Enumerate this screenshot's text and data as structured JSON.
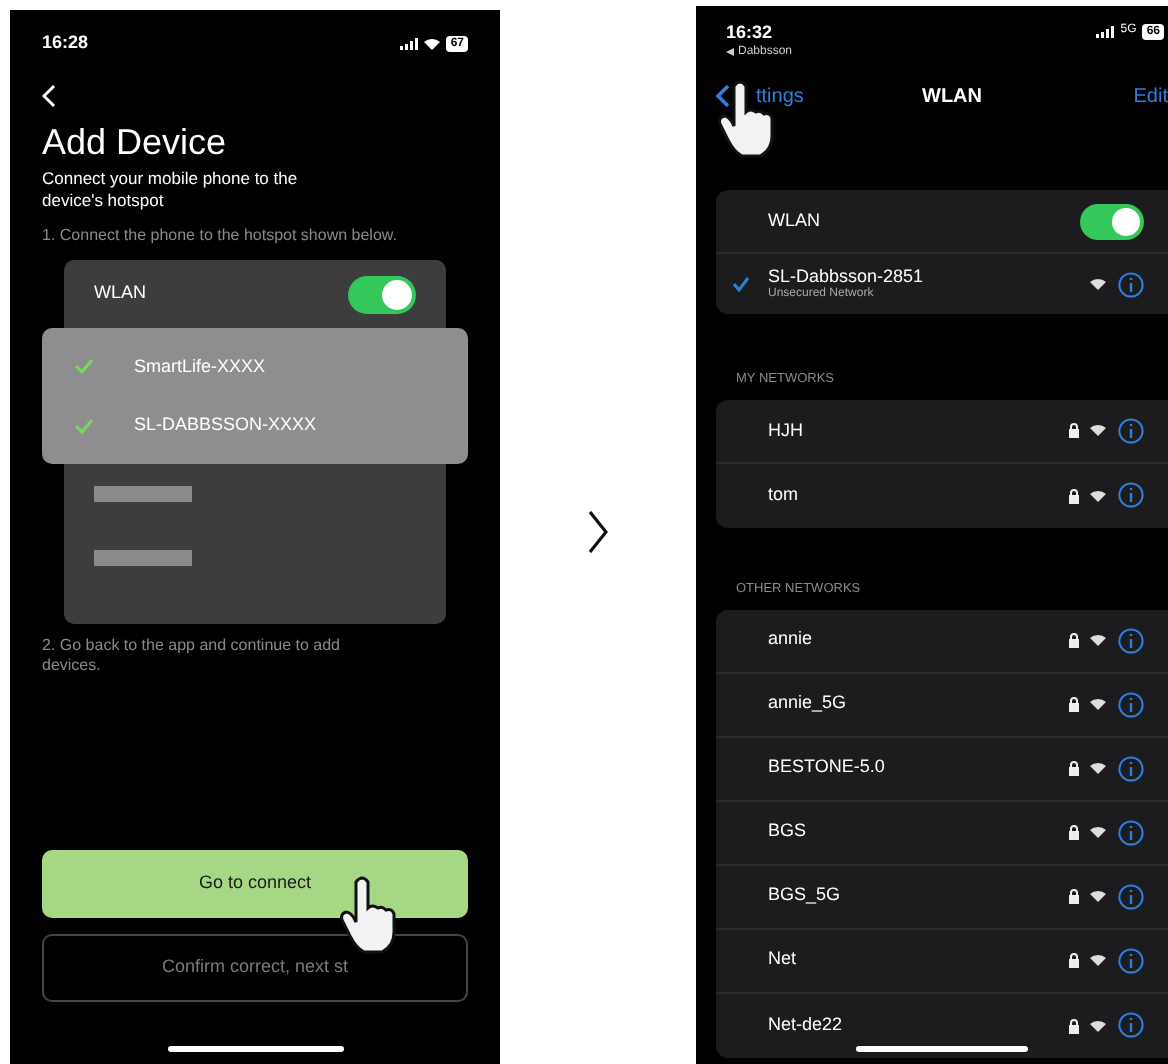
{
  "left_screen": {
    "status_bar": {
      "time": "16:28",
      "battery": "67"
    },
    "title": "Add Device",
    "subtitle": "Connect your mobile phone to the device's hotspot",
    "step_1": "1. Connect the phone to the hotspot shown below.",
    "wlan_card": {
      "label": "WLAN",
      "on": true
    },
    "hotspot_popup": [
      {
        "name": "SmartLife-XXXX",
        "checked": true
      },
      {
        "name": "SL-DABBSSON-XXXX",
        "checked": true
      }
    ],
    "step_2": "2. Go back to the app and continue to add devices.",
    "buttons": [
      {
        "label": "Go to connect",
        "kind": "primary"
      },
      {
        "label": "Confirm correct, next st",
        "kind": "outline"
      }
    ]
  },
  "right_screen": {
    "status_bar": {
      "time": "16:32",
      "back_app": "Dabbsson",
      "network": "5G",
      "battery": "66"
    },
    "nav": {
      "back": "ttings",
      "title": "WLAN",
      "action": "Edit"
    },
    "wlan": {
      "label": "WLAN",
      "on": true
    },
    "connected": {
      "name": "SL-Dabbsson-2851",
      "detail": "Unsecured Network"
    },
    "sections": [
      {
        "header": "MY NETWORKS",
        "networks": [
          {
            "name": "HJH",
            "locked": true
          },
          {
            "name": "tom",
            "locked": true
          }
        ]
      },
      {
        "header": "OTHER NETWORKS",
        "networks": [
          {
            "name": "annie",
            "locked": true
          },
          {
            "name": "annie_5G",
            "locked": true
          },
          {
            "name": "BESTONE-5.0",
            "locked": true
          },
          {
            "name": "BGS",
            "locked": true
          },
          {
            "name": "BGS_5G",
            "locked": true
          },
          {
            "name": "Net",
            "locked": true
          },
          {
            "name": "Net-de22",
            "locked": true
          }
        ]
      }
    ]
  }
}
